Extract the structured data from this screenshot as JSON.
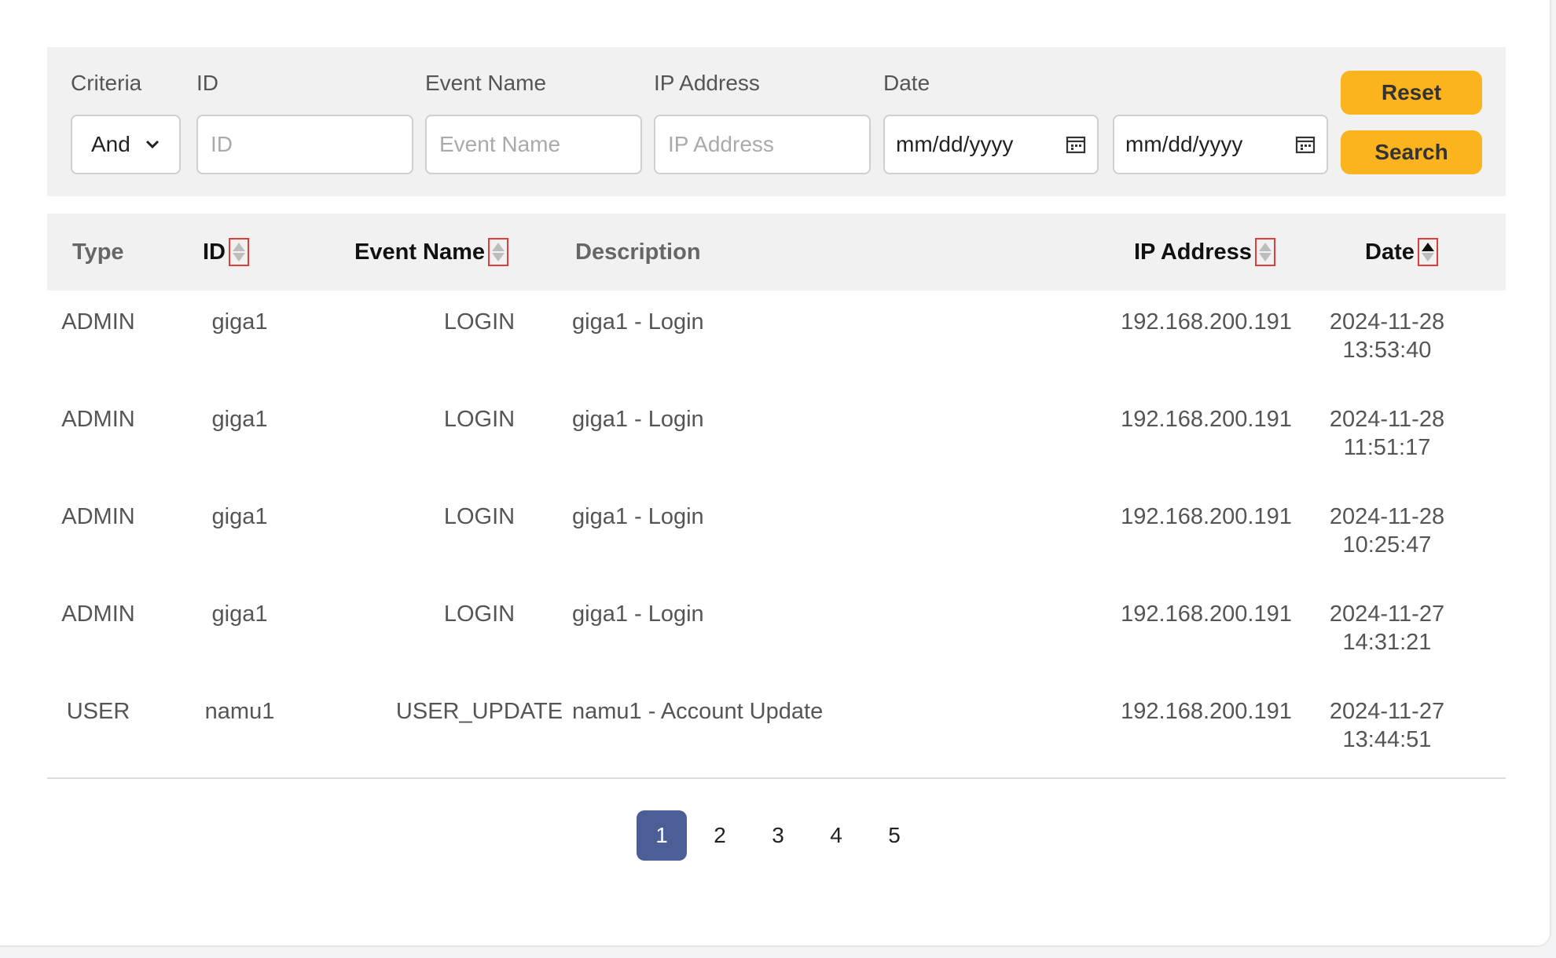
{
  "filter": {
    "labels": {
      "criteria": "Criteria",
      "id": "ID",
      "event_name": "Event Name",
      "ip_address": "IP Address",
      "date": "Date"
    },
    "criteria_value": "And",
    "placeholders": {
      "id": "ID",
      "event_name": "Event Name",
      "ip_address": "IP Address"
    },
    "date_from": "mm/dd/yyyy",
    "date_to": "mm/dd/yyyy",
    "reset_label": "Reset",
    "search_label": "Search",
    "accent_color": "#fbb41e"
  },
  "table": {
    "headers": {
      "type": "Type",
      "id": "ID",
      "event_name": "Event Name",
      "description": "Description",
      "ip_address": "IP Address",
      "date": "Date"
    },
    "active_sort": "date",
    "rows": [
      {
        "type": "ADMIN",
        "id": "giga1",
        "event": "LOGIN",
        "description": "giga1 - Login",
        "ip": "192.168.200.191",
        "date": "2024-11-28",
        "time": "13:53:40"
      },
      {
        "type": "ADMIN",
        "id": "giga1",
        "event": "LOGIN",
        "description": "giga1 - Login",
        "ip": "192.168.200.191",
        "date": "2024-11-28",
        "time": "11:51:17"
      },
      {
        "type": "ADMIN",
        "id": "giga1",
        "event": "LOGIN",
        "description": "giga1 - Login",
        "ip": "192.168.200.191",
        "date": "2024-11-28",
        "time": "10:25:47"
      },
      {
        "type": "ADMIN",
        "id": "giga1",
        "event": "LOGIN",
        "description": "giga1 - Login",
        "ip": "192.168.200.191",
        "date": "2024-11-27",
        "time": "14:31:21"
      },
      {
        "type": "USER",
        "id": "namu1",
        "event": "USER_UPDATE",
        "description": "namu1 - Account Update",
        "ip": "192.168.200.191",
        "date": "2024-11-27",
        "time": "13:44:51"
      }
    ]
  },
  "pagination": {
    "pages": [
      "1",
      "2",
      "3",
      "4",
      "5"
    ],
    "current": "1",
    "active_color": "#4b5e95"
  }
}
